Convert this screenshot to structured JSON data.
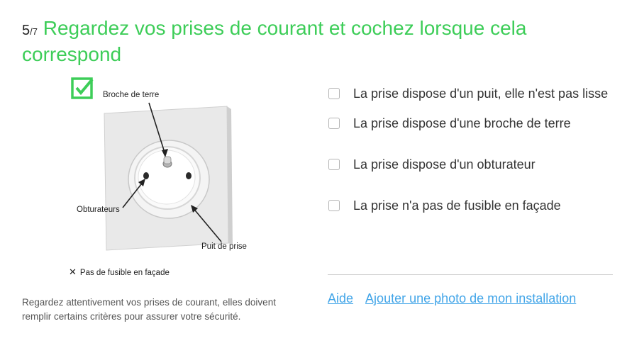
{
  "header": {
    "step_current": "5",
    "step_total": "/7",
    "title": " Regardez vos prises de courant et cochez lorsque cela correspond"
  },
  "figure": {
    "labels": {
      "earth_pin": "Broche de terre",
      "shutters": "Obturateurs",
      "socket_well": "Puit de prise"
    },
    "caption_icon": "close-icon",
    "caption": "Pas de fusible en façade",
    "badge_icon": "checked-box-icon",
    "accent_color": "#3dcd58"
  },
  "description": "Regardez attentivement vos prises de courant, elles doivent remplir certains critères pour assurer votre sécurité.",
  "options": [
    {
      "label": "La prise dispose d'un puit, elle n'est pas lisse",
      "checked": false
    },
    {
      "label": "La prise dispose d'une broche de terre",
      "checked": false
    },
    {
      "label": "La prise dispose d'un obturateur",
      "checked": false
    },
    {
      "label": "La prise n'a pas de fusible en façade",
      "checked": false
    }
  ],
  "links": {
    "help": "Aide",
    "add_photo": "Ajouter une photo de mon installation",
    "color": "#42a5e8"
  }
}
